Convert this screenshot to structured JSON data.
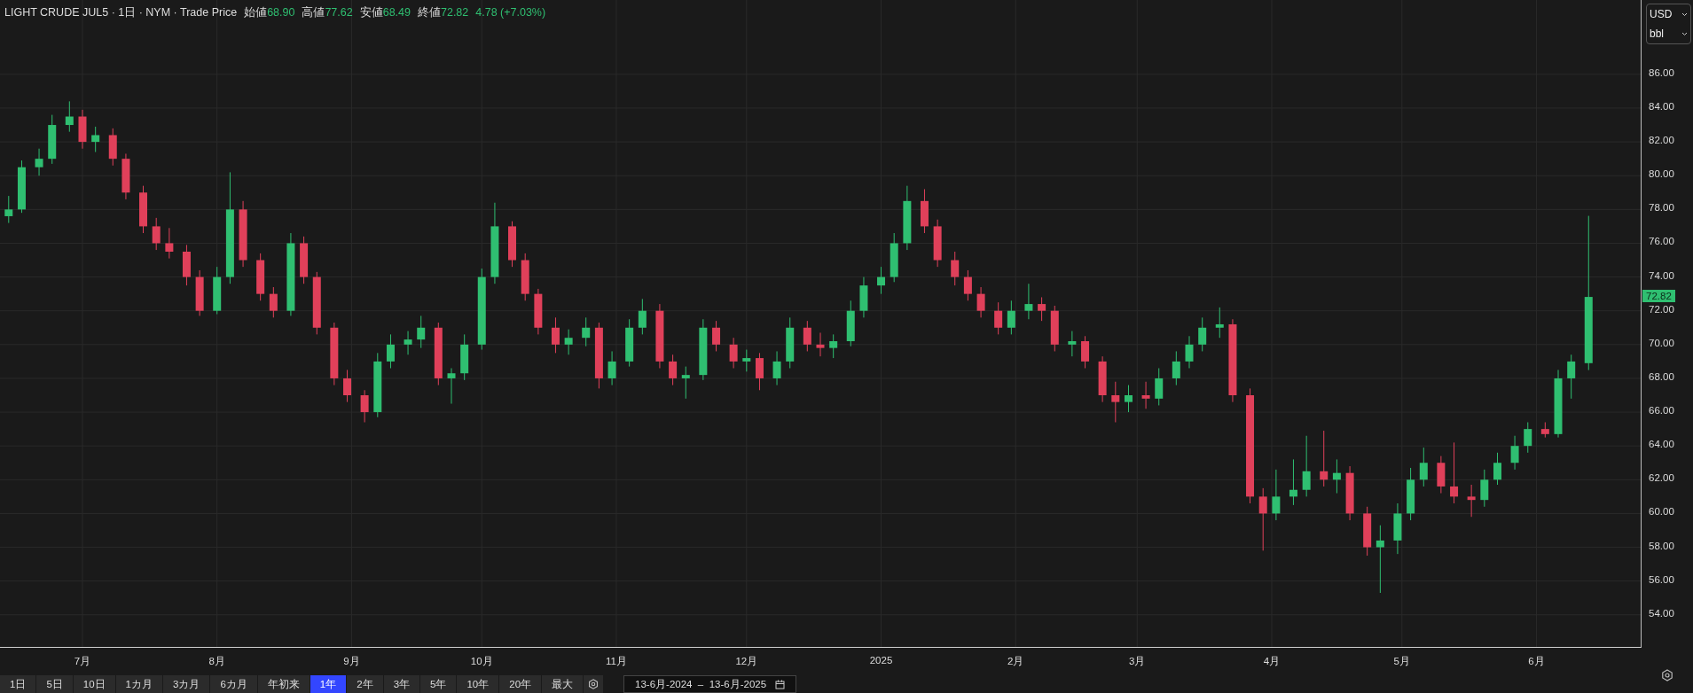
{
  "header": {
    "title": "LIGHT CRUDE JUL5 · 1日 · NYM · Trade Price",
    "stats": [
      {
        "label": "始値",
        "value": "68.90"
      },
      {
        "label": "高値",
        "value": "77.62"
      },
      {
        "label": "安値",
        "value": "68.49"
      },
      {
        "label": "終値",
        "value": "72.82"
      }
    ],
    "change": "4.78 (+7.03%)"
  },
  "currency_select": "USD",
  "unit_select": "bbl",
  "chart_data": {
    "type": "candlestick",
    "ylim": [
      52.1,
      90.4
    ],
    "xlim": [
      "2024-06-12",
      "2025-06-25"
    ],
    "grid": true,
    "yticks": [
      {
        "value": 86,
        "label": "86.00"
      },
      {
        "value": 84,
        "label": "84.00"
      },
      {
        "value": 82,
        "label": "82.00"
      },
      {
        "value": 80,
        "label": "80.00"
      },
      {
        "value": 78,
        "label": "78.00"
      },
      {
        "value": 76,
        "label": "76.00"
      },
      {
        "value": 74,
        "label": "74.00"
      },
      {
        "value": 72,
        "label": "72.00"
      },
      {
        "value": 70,
        "label": "70.00"
      },
      {
        "value": 68,
        "label": "68.00"
      },
      {
        "value": 66,
        "label": "66.00"
      },
      {
        "value": 64,
        "label": "64.00"
      },
      {
        "value": 62,
        "label": "62.00"
      },
      {
        "value": 60,
        "label": "60.00"
      },
      {
        "value": 58,
        "label": "58.00"
      },
      {
        "value": 56,
        "label": "56.00"
      },
      {
        "value": 54,
        "label": "54.00"
      }
    ],
    "xticks": [
      {
        "value": "2024-07-01",
        "label": "7月"
      },
      {
        "value": "2024-08-01",
        "label": "8月"
      },
      {
        "value": "2024-09-01",
        "label": "9月"
      },
      {
        "value": "2024-10-01",
        "label": "10月"
      },
      {
        "value": "2024-11-01",
        "label": "11月"
      },
      {
        "value": "2024-12-01",
        "label": "12月"
      },
      {
        "value": "2025-01-01",
        "label": "2025"
      },
      {
        "value": "2025-02-01",
        "label": "2月"
      },
      {
        "value": "2025-03-01",
        "label": "3月"
      },
      {
        "value": "2025-04-01",
        "label": "4月"
      },
      {
        "value": "2025-05-01",
        "label": "5月"
      },
      {
        "value": "2025-06-01",
        "label": "6月"
      }
    ],
    "x": [
      "2024-06-14",
      "2024-06-17",
      "2024-06-21",
      "2024-06-24",
      "2024-06-28",
      "2024-07-01",
      "2024-07-04",
      "2024-07-08",
      "2024-07-11",
      "2024-07-15",
      "2024-07-18",
      "2024-07-21",
      "2024-07-25",
      "2024-07-28",
      "2024-08-01",
      "2024-08-04",
      "2024-08-07",
      "2024-08-11",
      "2024-08-14",
      "2024-08-18",
      "2024-08-21",
      "2024-08-24",
      "2024-08-28",
      "2024-08-31",
      "2024-09-04",
      "2024-09-07",
      "2024-09-10",
      "2024-09-14",
      "2024-09-17",
      "2024-09-21",
      "2024-09-24",
      "2024-09-27",
      "2024-10-01",
      "2024-10-04",
      "2024-10-08",
      "2024-10-11",
      "2024-10-14",
      "2024-10-18",
      "2024-10-21",
      "2024-10-25",
      "2024-10-28",
      "2024-10-31",
      "2024-11-04",
      "2024-11-07",
      "2024-11-11",
      "2024-11-14",
      "2024-11-17",
      "2024-11-21",
      "2024-11-24",
      "2024-11-28",
      "2024-12-01",
      "2024-12-04",
      "2024-12-08",
      "2024-12-11",
      "2024-12-15",
      "2024-12-18",
      "2024-12-21",
      "2024-12-25",
      "2024-12-28",
      "2025-01-01",
      "2025-01-04",
      "2025-01-07",
      "2025-01-11",
      "2025-01-14",
      "2025-01-18",
      "2025-01-21",
      "2025-01-24",
      "2025-01-28",
      "2025-01-31",
      "2025-02-04",
      "2025-02-07",
      "2025-02-10",
      "2025-02-14",
      "2025-02-17",
      "2025-02-21",
      "2025-02-24",
      "2025-02-27",
      "2025-03-03",
      "2025-03-06",
      "2025-03-10",
      "2025-03-13",
      "2025-03-16",
      "2025-03-20",
      "2025-03-23",
      "2025-03-27",
      "2025-03-30",
      "2025-04-02",
      "2025-04-06",
      "2025-04-09",
      "2025-04-13",
      "2025-04-16",
      "2025-04-19",
      "2025-04-23",
      "2025-04-26",
      "2025-04-30",
      "2025-05-03",
      "2025-05-06",
      "2025-05-10",
      "2025-05-13",
      "2025-05-17",
      "2025-05-20",
      "2025-05-23",
      "2025-05-27",
      "2025-05-30",
      "2025-06-03",
      "2025-06-06",
      "2025-06-09",
      "2025-06-13"
    ],
    "ohlc": [
      [
        77.6,
        78.8,
        77.2,
        78
      ],
      [
        78,
        80.9,
        77.8,
        80.5
      ],
      [
        80.5,
        81.6,
        80,
        81
      ],
      [
        81,
        83.6,
        80.7,
        83
      ],
      [
        83,
        84.4,
        82.6,
        83.5
      ],
      [
        83.5,
        83.9,
        81.6,
        82
      ],
      [
        82,
        82.9,
        81.4,
        82.4
      ],
      [
        82.4,
        82.8,
        80.6,
        81
      ],
      [
        81,
        81.3,
        78.6,
        79
      ],
      [
        79,
        79.4,
        76.6,
        77
      ],
      [
        77,
        77.5,
        75.6,
        76
      ],
      [
        76,
        76.9,
        75.1,
        75.5
      ],
      [
        75.5,
        75.9,
        73.5,
        74
      ],
      [
        74,
        74.4,
        71.7,
        72
      ],
      [
        72,
        74.6,
        71.8,
        74
      ],
      [
        74,
        80.2,
        73.6,
        78
      ],
      [
        78,
        78.5,
        74.6,
        75
      ],
      [
        75,
        75.4,
        72.6,
        73
      ],
      [
        73,
        73.4,
        71.6,
        72
      ],
      [
        72,
        76.6,
        71.7,
        76
      ],
      [
        76,
        76.4,
        73.6,
        74
      ],
      [
        74,
        74.3,
        70.6,
        71
      ],
      [
        71,
        71.3,
        67.6,
        68
      ],
      [
        68,
        68.5,
        66.6,
        67
      ],
      [
        67,
        67.3,
        65.4,
        66
      ],
      [
        66,
        69.5,
        65.7,
        69
      ],
      [
        69,
        70.6,
        68.6,
        70
      ],
      [
        70,
        70.8,
        69.4,
        70.3
      ],
      [
        70.3,
        71.7,
        69.8,
        71
      ],
      [
        71,
        71.3,
        67.6,
        68
      ],
      [
        68,
        68.6,
        66.5,
        68.3
      ],
      [
        68.3,
        70.6,
        67.9,
        70
      ],
      [
        70,
        74.5,
        69.7,
        74
      ],
      [
        74,
        78.4,
        73.6,
        77
      ],
      [
        77,
        77.3,
        74.6,
        75
      ],
      [
        75,
        75.4,
        72.6,
        73
      ],
      [
        73,
        73.3,
        70.6,
        71
      ],
      [
        71,
        71.6,
        69.5,
        70
      ],
      [
        70,
        70.9,
        69.4,
        70.4
      ],
      [
        70.4,
        71.6,
        69.9,
        71
      ],
      [
        71,
        71.3,
        67.4,
        68
      ],
      [
        68,
        69.6,
        67.6,
        69
      ],
      [
        69,
        71.5,
        68.7,
        71
      ],
      [
        71,
        72.7,
        70.6,
        72
      ],
      [
        72,
        72.4,
        68.6,
        69
      ],
      [
        69,
        69.4,
        67.6,
        68
      ],
      [
        68,
        68.7,
        66.8,
        68.2
      ],
      [
        68.2,
        71.5,
        67.9,
        71
      ],
      [
        71,
        71.4,
        69.6,
        70
      ],
      [
        70,
        70.4,
        68.6,
        69
      ],
      [
        69,
        69.7,
        68.4,
        69.2
      ],
      [
        69.2,
        69.5,
        67.3,
        68
      ],
      [
        68,
        69.6,
        67.6,
        69
      ],
      [
        69,
        71.6,
        68.6,
        71
      ],
      [
        71,
        71.4,
        69.6,
        70
      ],
      [
        70,
        70.7,
        69.3,
        69.8
      ],
      [
        69.8,
        70.6,
        69.2,
        70.2
      ],
      [
        70.2,
        72.6,
        69.9,
        72
      ],
      [
        72,
        74,
        71.6,
        73.5
      ],
      [
        73.5,
        74.6,
        73,
        74
      ],
      [
        74,
        76.6,
        73.7,
        76
      ],
      [
        76,
        79.4,
        75.6,
        78.5
      ],
      [
        78.5,
        79.2,
        76.6,
        77
      ],
      [
        77,
        77.4,
        74.6,
        75
      ],
      [
        75,
        75.5,
        73.5,
        74
      ],
      [
        74,
        74.4,
        72.6,
        73
      ],
      [
        73,
        73.4,
        71.6,
        72
      ],
      [
        72,
        72.5,
        70.6,
        71
      ],
      [
        71,
        72.6,
        70.6,
        72
      ],
      [
        72,
        73.6,
        71.5,
        72.4
      ],
      [
        72.4,
        72.8,
        71.4,
        72
      ],
      [
        72,
        72.3,
        69.6,
        70
      ],
      [
        70,
        70.8,
        69.3,
        70.2
      ],
      [
        70.2,
        70.5,
        68.6,
        69
      ],
      [
        69,
        69.3,
        66.6,
        67
      ],
      [
        67,
        67.8,
        65.4,
        66.6
      ],
      [
        66.6,
        67.6,
        66,
        67
      ],
      [
        67,
        67.8,
        66.2,
        66.8
      ],
      [
        66.8,
        68.6,
        66.4,
        68
      ],
      [
        68,
        69.6,
        67.6,
        69
      ],
      [
        69,
        70.5,
        68.6,
        70
      ],
      [
        70,
        71.6,
        69.6,
        71
      ],
      [
        71,
        72.2,
        70.4,
        71.2
      ],
      [
        71.2,
        71.5,
        66.6,
        67
      ],
      [
        67,
        67.4,
        60.6,
        61
      ],
      [
        61,
        61.5,
        57.8,
        60
      ],
      [
        60,
        62.6,
        59.6,
        61
      ],
      [
        61,
        63.2,
        60.5,
        61.4
      ],
      [
        61.4,
        64.6,
        61,
        62.5
      ],
      [
        62.5,
        64.9,
        61.6,
        62
      ],
      [
        62,
        63.2,
        61.2,
        62.4
      ],
      [
        62.4,
        62.8,
        59.6,
        60
      ],
      [
        60,
        60.4,
        57.5,
        58
      ],
      [
        58,
        59.3,
        55.3,
        58.4
      ],
      [
        58.4,
        60.6,
        57.6,
        60
      ],
      [
        60,
        62.7,
        59.6,
        62
      ],
      [
        62,
        63.9,
        61.6,
        63
      ],
      [
        63,
        63.4,
        61.2,
        61.6
      ],
      [
        61.6,
        64.2,
        60.6,
        61
      ],
      [
        61,
        61.7,
        59.8,
        60.8
      ],
      [
        60.8,
        62.6,
        60.4,
        62
      ],
      [
        62,
        63.6,
        61.7,
        63
      ],
      [
        63,
        64.6,
        62.6,
        64
      ],
      [
        64,
        65.4,
        63.6,
        65
      ],
      [
        65,
        65.4,
        64.5,
        64.7
      ],
      [
        64.7,
        68.5,
        64.5,
        68
      ],
      [
        68,
        69.4,
        66.8,
        69
      ],
      [
        68.9,
        77.62,
        68.49,
        72.82
      ]
    ]
  },
  "last_price": "72.82",
  "ranges": [
    {
      "label": "1日",
      "selected": false
    },
    {
      "label": "5日",
      "selected": false
    },
    {
      "label": "10日",
      "selected": false
    },
    {
      "label": "1カ月",
      "selected": false
    },
    {
      "label": "3カ月",
      "selected": false
    },
    {
      "label": "6カ月",
      "selected": false
    },
    {
      "label": "年初来",
      "selected": false
    },
    {
      "label": "1年",
      "selected": true
    },
    {
      "label": "2年",
      "selected": false
    },
    {
      "label": "3年",
      "selected": false
    },
    {
      "label": "5年",
      "selected": false
    },
    {
      "label": "10年",
      "selected": false
    },
    {
      "label": "20年",
      "selected": false
    },
    {
      "label": "最大",
      "selected": false
    }
  ],
  "date_range": "13-6月-2024  –  13-6月-2025"
}
